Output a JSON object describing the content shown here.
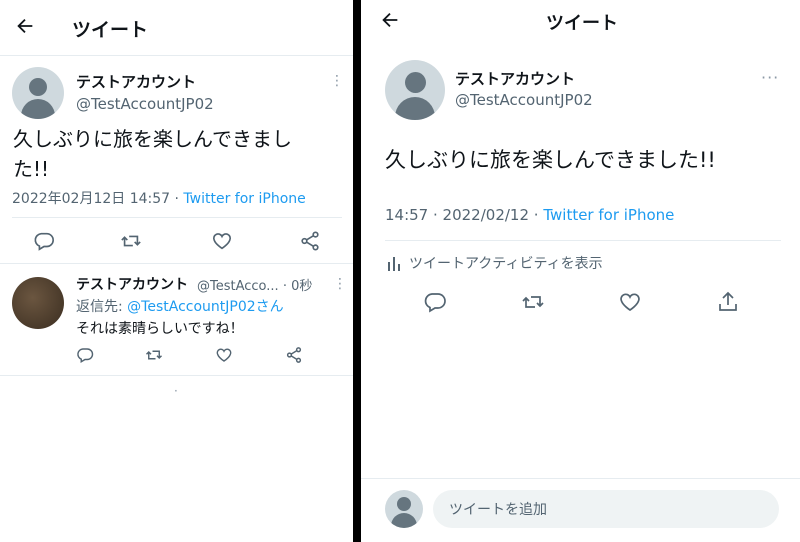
{
  "left": {
    "header": {
      "title": "ツイート"
    },
    "tweet": {
      "display_name": "テストアカウント",
      "handle": "@TestAccountJP02",
      "text_line1": "久しぶりに旅を楽しんできまし",
      "text_line2": "た!!",
      "datetime": "2022年02月12日 14:57",
      "dot": " · ",
      "source": "Twitter for iPhone",
      "more": "⋮"
    },
    "reply": {
      "display_name": "テストアカウント",
      "handle_time": "@TestAcco... · 0秒",
      "replying_prefix": "返信先: ",
      "replying_to": "@TestAccountJP02さん",
      "text": "それは素晴らしいですね！",
      "more": "⋮"
    },
    "footer_dot": "·"
  },
  "right": {
    "header": {
      "title": "ツイート"
    },
    "tweet": {
      "display_name": "テストアカウント",
      "handle": "@TestAccountJP02",
      "text": "久しぶりに旅を楽しんできました!!",
      "time": "14:57",
      "dot1": " · ",
      "date": "2022/02/12",
      "dot2": " · ",
      "source": "Twitter for iPhone",
      "more": "···"
    },
    "activity_label": "ツイートアクティビティを表示",
    "reply_placeholder": "ツイートを追加"
  },
  "colors": {
    "accent": "#1d9bf0",
    "icon_gray": "#536471",
    "divider": "#000000",
    "avatar_bg": "#cfd9de",
    "reply_avatar": "#4a3a2c"
  },
  "icons": [
    "back-arrow-icon",
    "reply-icon",
    "retweet-icon",
    "like-icon",
    "share-icon",
    "analytics-icon"
  ]
}
